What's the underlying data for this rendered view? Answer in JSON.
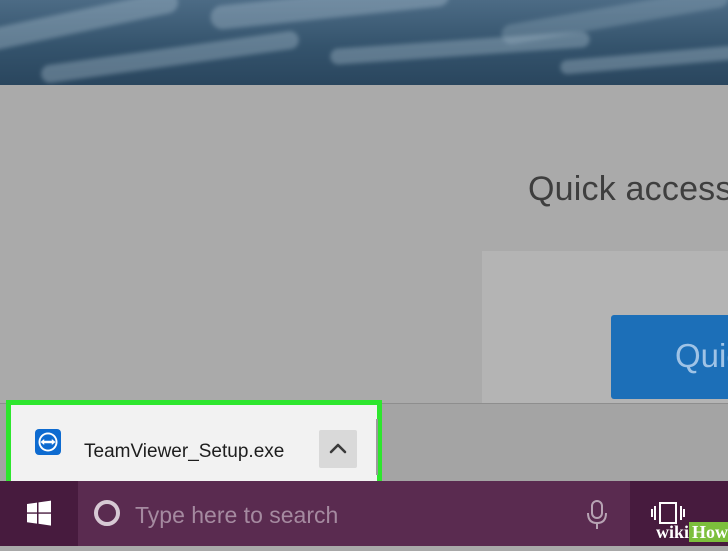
{
  "quick_access": {
    "title": "Quick access",
    "button_label": "Quic"
  },
  "download": {
    "file_name": "TeamViewer_Setup.exe",
    "file_icon": "teamviewer-icon",
    "menu_icon": "chevron-up-icon",
    "highlight_color": "#2ee62e"
  },
  "taskbar": {
    "start_icon": "windows-logo-icon",
    "search_placeholder": "Type here to search",
    "search_icon": "cortana-icon",
    "mic_icon": "microphone-icon",
    "taskview_icon": "task-view-icon",
    "color": "#471b3e"
  },
  "watermark": {
    "part1": "wiki",
    "part2": "How"
  }
}
